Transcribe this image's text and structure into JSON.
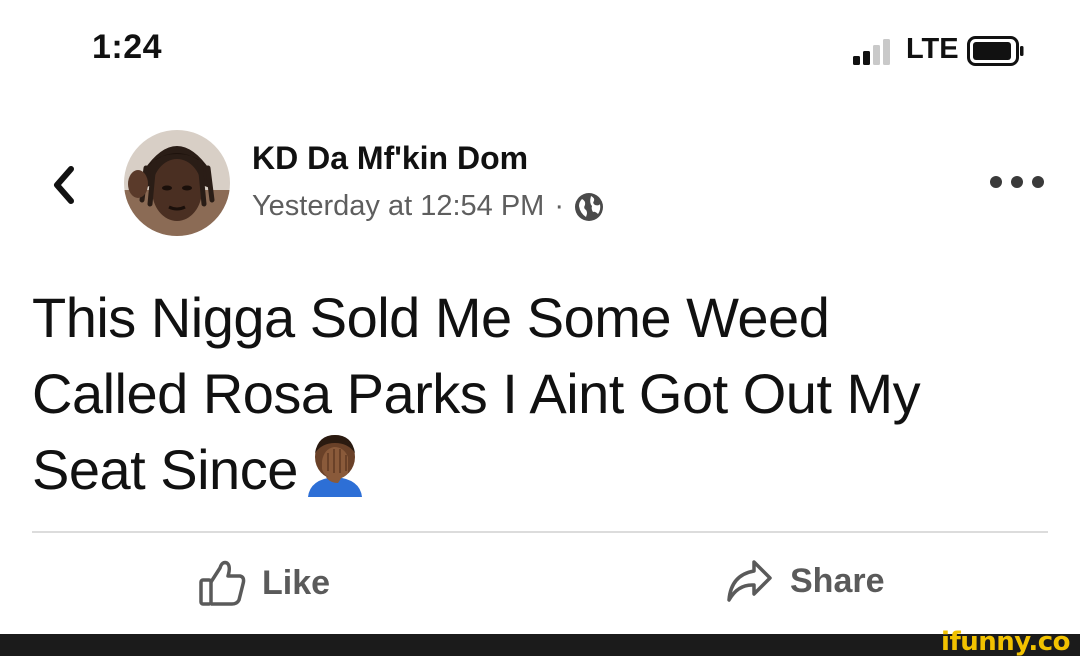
{
  "status_bar": {
    "time": "1:24",
    "network": "LTE",
    "signal_bars": 2,
    "signal_total": 4
  },
  "post": {
    "author": "KD Da Mf'kin Dom",
    "timestamp": "Yesterday at 12:54 PM",
    "separator": "·",
    "privacy_icon": "globe-icon",
    "text_lines": [
      "This Nigga Sold Me Some Weed",
      "Called Rosa Parks I Aint Got Out My",
      "Seat Since"
    ],
    "emoji": "facepalm-icon"
  },
  "actions": {
    "like_label": "Like",
    "share_label": "Share"
  },
  "watermark": {
    "text": "ifunny.co"
  },
  "colors": {
    "text": "#111111",
    "meta": "#5e5e5e",
    "action": "#5a5a5a",
    "watermark": "#f2c200",
    "footer": "#1b1b1b"
  }
}
